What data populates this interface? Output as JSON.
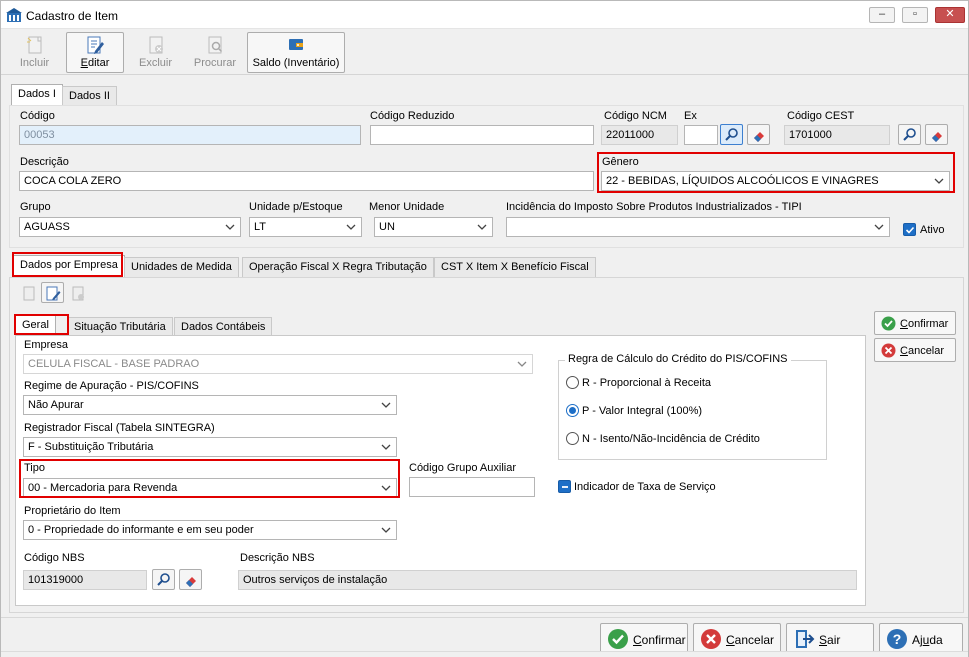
{
  "window": {
    "title": "Cadastro de Item",
    "minimize": "–",
    "maximize": "▫",
    "close": "✕"
  },
  "toolbar": {
    "incluir": "Incluir",
    "editar": "Editar",
    "excluir": "Excluir",
    "procurar": "Procurar",
    "saldo": "Saldo (Inventário)"
  },
  "top_tabs": [
    "Dados I",
    "Dados II"
  ],
  "form": {
    "codigo_label": "Código",
    "codigo": "00053",
    "codigo_reduzido_label": "Código Reduzido",
    "codigo_reduzido": "",
    "ncm_label": "Código NCM",
    "ncm": "22011000",
    "ex_label": "Ex",
    "ex": "",
    "cest_label": "Código CEST",
    "cest": "1701000",
    "descricao_label": "Descrição",
    "descricao": "COCA COLA ZERO",
    "genero_label": "Gênero",
    "genero": "22 - BEBIDAS, LÍQUIDOS ALCOÓLICOS E VINAGRES",
    "grupo_label": "Grupo",
    "grupo": "AGUASS",
    "unidade_label": "Unidade p/Estoque",
    "unidade": "LT",
    "menor_unidade_label": "Menor Unidade",
    "menor_unidade": "UN",
    "tipi_label": "Incidência do Imposto Sobre Produtos Industrializados - TIPI",
    "tipi": "",
    "ativo_label": "Ativo",
    "ativo": true
  },
  "mid_tabs": [
    "Dados por Empresa",
    "Unidades de Medida",
    "Operação Fiscal X Regra Tributação",
    "CST X Item X Benefício Fiscal"
  ],
  "inner_tabs": [
    "Geral",
    "Situação Tributária",
    "Dados Contábeis"
  ],
  "geral": {
    "empresa_label": "Empresa",
    "empresa": "CELULA FISCAL - BASE PADRAO",
    "regime_label": "Regime de Apuração - PIS/COFINS",
    "regime": "Não Apurar",
    "registrador_label": "Registrador Fiscal (Tabela SINTEGRA)",
    "registrador": "F - Substituição Tributária",
    "tipo_label": "Tipo",
    "tipo": "00 - Mercadoria para Revenda",
    "grupo_aux_label": "Código Grupo Auxiliar",
    "grupo_aux": "",
    "proprietario_label": "Proprietário do Item",
    "proprietario": "0 - Propriedade do informante e em seu poder",
    "nbs_label": "Código NBS",
    "nbs": "101319000",
    "desc_nbs_label": "Descrição NBS",
    "desc_nbs": "Outros serviços de instalação",
    "regra_title": "Regra de Cálculo do Crédito do PIS/COFINS",
    "regra_options": [
      "R - Proporcional à Receita",
      "P - Valor Integral (100%)",
      "N - Isento/Não-Incidência de Crédito"
    ],
    "regra_selected": "P - Valor Integral (100%)",
    "indicador_label": "Indicador de Taxa de Serviço"
  },
  "side_buttons": {
    "confirmar": "Confirmar",
    "cancelar": "Cancelar"
  },
  "bottom_buttons": {
    "confirmar": "Confirmar",
    "cancelar": "Cancelar",
    "sair": "Sair",
    "ajuda": "Ajuda"
  },
  "colors": {
    "highlight": "#e10000",
    "accent": "#1e6fc7"
  }
}
